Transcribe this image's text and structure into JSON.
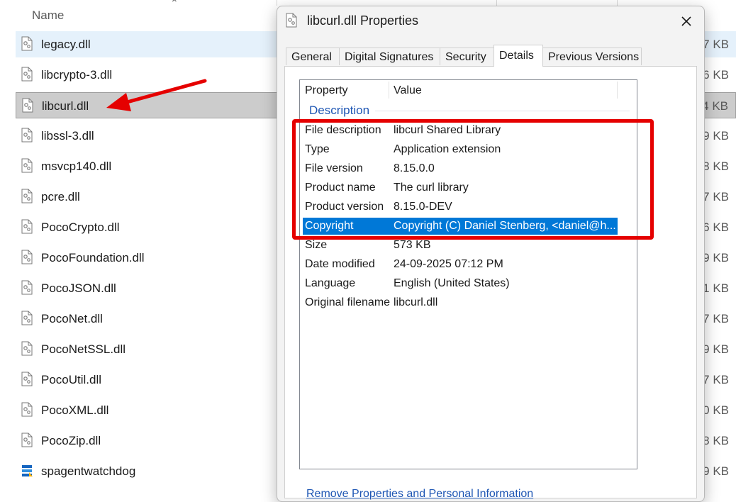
{
  "explorer": {
    "column_name": "Name",
    "files": [
      {
        "name": "legacy.dll",
        "size": "7 KB"
      },
      {
        "name": "libcrypto-3.dll",
        "size": "6 KB"
      },
      {
        "name": "libcurl.dll",
        "size": "4 KB"
      },
      {
        "name": "libssl-3.dll",
        "size": "9 KB"
      },
      {
        "name": "msvcp140.dll",
        "size": "8 KB"
      },
      {
        "name": "pcre.dll",
        "size": "7 KB"
      },
      {
        "name": "PocoCrypto.dll",
        "size": "6 KB"
      },
      {
        "name": "PocoFoundation.dll",
        "size": "9 KB"
      },
      {
        "name": "PocoJSON.dll",
        "size": "1 KB"
      },
      {
        "name": "PocoNet.dll",
        "size": "7 KB"
      },
      {
        "name": "PocoNetSSL.dll",
        "size": "9 KB"
      },
      {
        "name": "PocoUtil.dll",
        "size": "7 KB"
      },
      {
        "name": "PocoXML.dll",
        "size": "0 KB"
      },
      {
        "name": "PocoZip.dll",
        "size": "8 KB"
      },
      {
        "name": "spagentwatchdog",
        "size": "9 KB"
      }
    ]
  },
  "dialog": {
    "title": "libcurl.dll Properties",
    "tabs": [
      "General",
      "Digital Signatures",
      "Security",
      "Details",
      "Previous Versions"
    ],
    "active_tab": "Details",
    "list_header": {
      "property": "Property",
      "value": "Value"
    },
    "group": "Description",
    "properties": [
      {
        "name": "File description",
        "value": "libcurl Shared Library"
      },
      {
        "name": "Type",
        "value": "Application extension"
      },
      {
        "name": "File version",
        "value": "8.15.0.0"
      },
      {
        "name": "Product name",
        "value": "The curl library"
      },
      {
        "name": "Product version",
        "value": "8.15.0-DEV"
      },
      {
        "name": "Copyright",
        "value": "Copyright (C) Daniel Stenberg, <daniel@h..."
      },
      {
        "name": "Size",
        "value": "573 KB"
      },
      {
        "name": "Date modified",
        "value": "24-09-2025 07:12 PM"
      },
      {
        "name": "Language",
        "value": "English (United States)"
      },
      {
        "name": "Original filename",
        "value": "libcurl.dll"
      }
    ],
    "selected_property": "Copyright",
    "remove_link": "Remove Properties and Personal Information"
  },
  "colors": {
    "selection_blue": "#0078d7",
    "annotation_red": "#e50000",
    "link_blue": "#1e56b4"
  },
  "icons": {
    "dll_file": "gear-file-icon",
    "app_file": "app-file-icon",
    "close": "close-icon"
  }
}
